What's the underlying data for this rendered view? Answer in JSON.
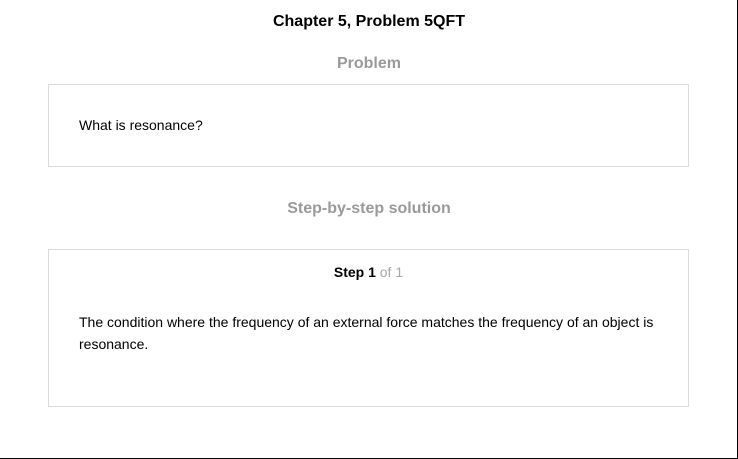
{
  "header": {
    "title": "Chapter 5, Problem 5QFT"
  },
  "problem": {
    "heading": "Problem",
    "text": "What is resonance?"
  },
  "solution": {
    "heading": "Step-by-step solution",
    "step_word": "Step 1",
    "step_total": " of 1",
    "text": "The condition where the frequency of an external force matches the frequency of an object is resonance."
  },
  "colors": {
    "heading_gray": "#9a9a9a",
    "border": "#dcdcdc"
  }
}
